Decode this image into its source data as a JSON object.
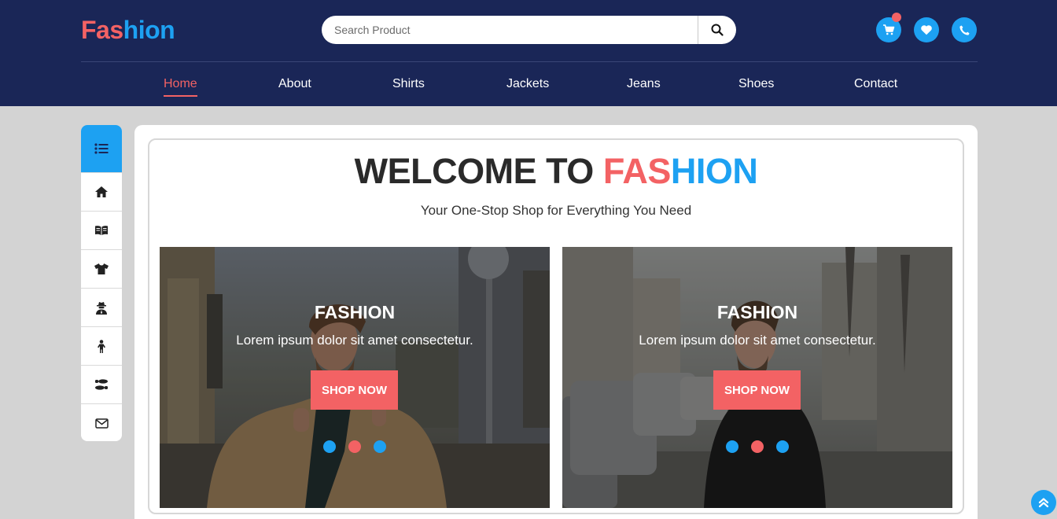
{
  "header": {
    "logo_part1": "Fas",
    "logo_part2": "hion",
    "search_placeholder": "Search Product",
    "icons": [
      "cart-icon",
      "heart-icon",
      "phone-icon"
    ]
  },
  "nav": {
    "items": [
      "Home",
      "About",
      "Shirts",
      "Jackets",
      "Jeans",
      "Shoes",
      "Contact"
    ],
    "active": "Home"
  },
  "sidebar": {
    "icons": [
      "list-icon",
      "home-icon",
      "book-open-icon",
      "shirt-icon",
      "user-secret-icon",
      "child-icon",
      "shoe-prints-icon",
      "envelope-icon"
    ]
  },
  "hero": {
    "title_part1": "WELCOME TO ",
    "title_part2": "FAS",
    "title_part3": "HION",
    "subtitle": "Your One-Stop Shop for Everything You Need"
  },
  "slides": [
    {
      "title": "FASHION",
      "text": "Lorem ipsum dolor sit amet consectetur.",
      "button": "SHOP NOW"
    },
    {
      "title": "FASHION",
      "text": "Lorem ipsum dolor sit amet consectetur.",
      "button": "SHOP NOW"
    }
  ],
  "colors": {
    "navy": "#1a2657",
    "accent_red": "#f36264",
    "accent_blue": "#1da1f2"
  }
}
